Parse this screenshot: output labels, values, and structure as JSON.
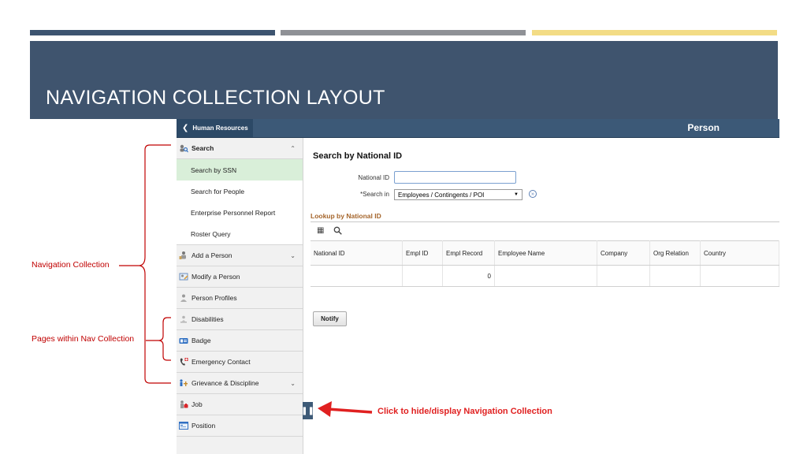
{
  "slide": {
    "title": "NAVIGATION COLLECTION LAYOUT",
    "colors": {
      "bar1": "#3d5470",
      "bar2": "#8f9196",
      "bar3": "#f3dc85",
      "title_band": "#3f546e"
    }
  },
  "header": {
    "back_label": "Human Resources",
    "page_title": "Person"
  },
  "nav": {
    "items": [
      {
        "label": "Search",
        "icon": "search-people-icon",
        "expanded": true
      },
      {
        "label": "Add a Person",
        "icon": "add-person-icon"
      },
      {
        "label": "Modify a Person",
        "icon": "modify-person-icon"
      },
      {
        "label": "Person Profiles",
        "icon": "person-profile-icon"
      },
      {
        "label": "Disabilities",
        "icon": "disabilities-icon"
      },
      {
        "label": "Badge",
        "icon": "badge-icon"
      },
      {
        "label": "Emergency Contact",
        "icon": "emergency-contact-icon"
      },
      {
        "label": "Grievance & Discipline",
        "icon": "grievance-icon"
      },
      {
        "label": "Job",
        "icon": "job-icon"
      },
      {
        "label": "Position",
        "icon": "position-icon"
      }
    ],
    "search_subitems": [
      {
        "label": "Search by SSN",
        "active": true
      },
      {
        "label": "Search for People"
      },
      {
        "label": "Enterprise Personnel Report"
      },
      {
        "label": "Roster Query"
      }
    ]
  },
  "content": {
    "heading": "Search by National ID",
    "national_id_label": "National ID",
    "national_id_value": "",
    "search_in_label": "*Search in",
    "search_in_value": "Employees / Contingents / POI",
    "lookup_title": "Lookup by National ID",
    "table": {
      "columns": [
        "National ID",
        "Empl ID",
        "Empl Record",
        "Employee Name",
        "Company",
        "Org Relation",
        "Country"
      ],
      "rows": [
        [
          "",
          "",
          "0",
          "",
          "",
          "",
          ""
        ]
      ]
    },
    "notify_label": "Notify"
  },
  "annotations": {
    "nav_collection": "Navigation Collection",
    "pages_within": "Pages within Nav Collection",
    "hide_display": "Click to hide/display Navigation Collection"
  }
}
